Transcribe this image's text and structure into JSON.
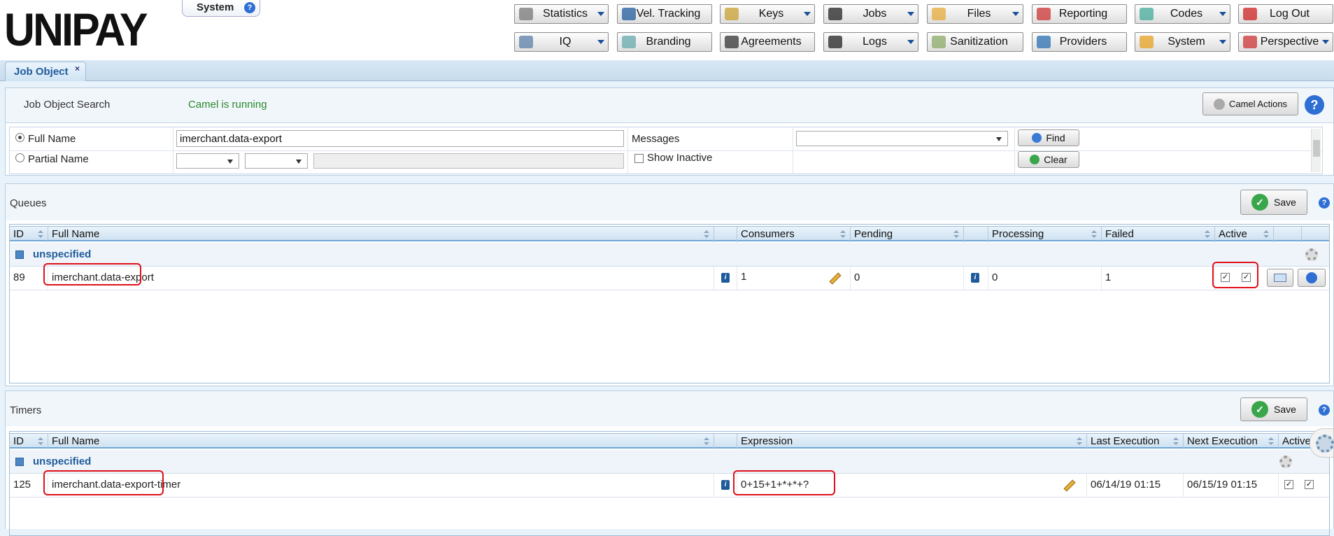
{
  "header": {
    "logo": "UNIPAY",
    "system_tab": "System",
    "menu_row1": [
      {
        "label": "Statistics",
        "icon": "chart-icon",
        "dropdown": true
      },
      {
        "label": "Vel. Tracking",
        "icon": "clock-icon",
        "dropdown": false
      },
      {
        "label": "Keys",
        "icon": "keys-icon",
        "dropdown": true
      },
      {
        "label": "Jobs",
        "icon": "arrow-icon",
        "dropdown": true
      },
      {
        "label": "Files",
        "icon": "folder-icon",
        "dropdown": true
      },
      {
        "label": "Reporting",
        "icon": "report-icon",
        "dropdown": false
      },
      {
        "label": "Codes",
        "icon": "codes-icon",
        "dropdown": true
      },
      {
        "label": "Log Out",
        "icon": "logout-icon",
        "dropdown": false
      }
    ],
    "menu_row2": [
      {
        "label": "IQ",
        "icon": "database-icon",
        "dropdown": true
      },
      {
        "label": "Branding",
        "icon": "brush-icon",
        "dropdown": false
      },
      {
        "label": "Agreements",
        "icon": "agreements-icon",
        "dropdown": false
      },
      {
        "label": "Logs",
        "icon": "pen-icon",
        "dropdown": true
      },
      {
        "label": "Sanitization",
        "icon": "broom-icon",
        "dropdown": false
      },
      {
        "label": "Providers",
        "icon": "globe-icon",
        "dropdown": false
      },
      {
        "label": "System",
        "icon": "system-icon",
        "dropdown": true
      },
      {
        "label": "Perspective",
        "icon": "tools-icon",
        "dropdown": true
      }
    ]
  },
  "tabs": [
    {
      "label": "Job Object",
      "close": "×"
    }
  ],
  "search": {
    "title": "Job Object Search",
    "status": "Camel is running",
    "camel_actions": "Camel Actions",
    "full_name_label": "Full Name",
    "partial_name_label": "Partial Name",
    "full_name_value": "imerchant.data-export",
    "messages_label": "Messages",
    "show_inactive": "Show Inactive",
    "find": "Find",
    "clear": "Clear"
  },
  "queues": {
    "title": "Queues",
    "save": "Save",
    "columns": [
      "ID",
      "Full Name",
      "Consumers",
      "Pending",
      "Processing",
      "Failed",
      "Active"
    ],
    "group": "unspecified",
    "rows": [
      {
        "id": "89",
        "full_name": "imerchant.data-export",
        "consumers": "1",
        "pending": "0",
        "processing": "0",
        "failed": "1"
      }
    ]
  },
  "timers": {
    "title": "Timers",
    "save": "Save",
    "columns": [
      "ID",
      "Full Name",
      "Expression",
      "Last Execution",
      "Next Execution",
      "Active"
    ],
    "group": "unspecified",
    "rows": [
      {
        "id": "125",
        "full_name": "imerchant.data-export-timer",
        "expression": "0+15+1+*+*+?",
        "last_execution": "06/14/19 01:15",
        "next_execution": "06/15/19 01:15"
      }
    ]
  },
  "colors": {
    "accent": "#1f5b9b",
    "status_green": "#2a8a2a",
    "highlight": "#e0101a"
  }
}
